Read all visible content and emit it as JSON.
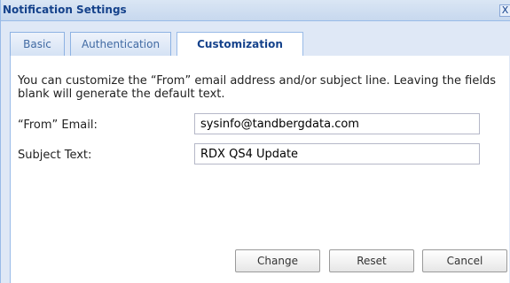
{
  "dialog": {
    "title": "Notification Settings",
    "close_glyph": "X"
  },
  "tabs": [
    {
      "label": "Basic",
      "active": false
    },
    {
      "label": "Authentication",
      "active": false
    },
    {
      "label": "Customization",
      "active": true
    }
  ],
  "customization": {
    "description": "You can customize the “From” email address and/or subject line. Leaving the fields blank will generate the default text.",
    "from_email_label": "“From” Email:",
    "from_email_value": "sysinfo@tandbergdata.com",
    "subject_label": "Subject Text:",
    "subject_value": "RDX QS4 Update"
  },
  "buttons": {
    "change": "Change",
    "reset": "Reset",
    "cancel": "Cancel"
  },
  "colors": {
    "title_text": "#15428b",
    "frame_border": "#99bbe8",
    "background": "#dfe8f6"
  }
}
